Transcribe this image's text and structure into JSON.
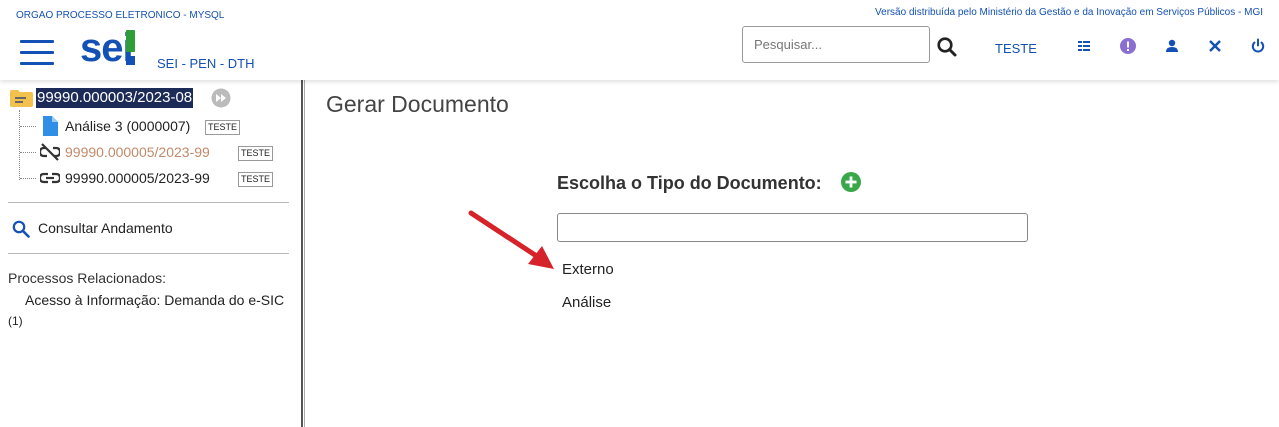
{
  "header": {
    "org_name": "ORGAO PROCESSO ELETRONICO - MYSQL",
    "distribution": "Versão distribuída pelo Ministério da Gestão e da Inovação em Serviços Públicos - MGI",
    "logo_text": "sei",
    "subtitle": "SEI - PEN - DTH",
    "search_placeholder": "Pesquisar...",
    "unit": "TESTE",
    "accent_color": "#1351b4"
  },
  "sidebar": {
    "process_number": "99990.000003/2023-08",
    "tree": [
      {
        "label": "Análise 3 (0000007)",
        "tag": "TESTE",
        "icon": "document-icon",
        "color": "#222222"
      },
      {
        "label": "99990.000005/2023-99",
        "tag": "TESTE",
        "icon": "unlink-icon",
        "color": "#c08a6a"
      },
      {
        "label": "99990.000005/2023-99",
        "tag": "TESTE",
        "icon": "link-icon",
        "color": "#222222"
      }
    ],
    "consult_label": "Consultar Andamento",
    "related_heading": "Processos Relacionados:",
    "related_item": "Acesso à Informação: Demanda do e-SIC",
    "related_count": "(1)"
  },
  "main": {
    "title": "Gerar Documento",
    "choose_label": "Escolha o Tipo do Documento:",
    "filter_value": "",
    "options": [
      "Externo",
      "Análise"
    ]
  }
}
